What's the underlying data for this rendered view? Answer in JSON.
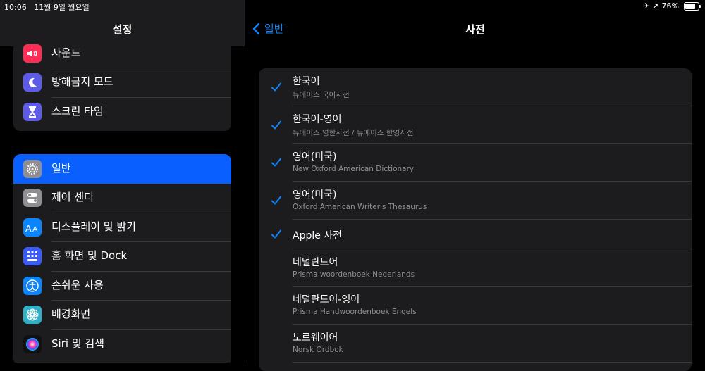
{
  "status": {
    "time": "10:06",
    "date": "11월 9일 월요일",
    "battery": "76%",
    "battery_level": 0.76
  },
  "sidebar": {
    "title": "설정",
    "group1": [
      {
        "label": "사운드",
        "icon": "speaker-icon",
        "color": "#ff2d55"
      },
      {
        "label": "방해금지 모드",
        "icon": "moon-icon",
        "color": "#5e5ce6"
      },
      {
        "label": "스크린 타임",
        "icon": "hourglass-icon",
        "color": "#5e5ce6"
      }
    ],
    "group2": [
      {
        "label": "일반",
        "icon": "gear-icon",
        "color": "#8e8e93",
        "selected": true
      },
      {
        "label": "제어 센터",
        "icon": "toggles-icon",
        "color": "#8e8e93"
      },
      {
        "label": "디스플레이 및 밝기",
        "icon": "text-size-icon",
        "color": "#0a84ff"
      },
      {
        "label": "홈 화면 및 Dock",
        "icon": "home-grid-icon",
        "color": "#3a5bff"
      },
      {
        "label": "손쉬운 사용",
        "icon": "accessibility-icon",
        "color": "#0a84ff"
      },
      {
        "label": "배경화면",
        "icon": "flower-icon",
        "color": "#30b0c7"
      },
      {
        "label": "Siri 및 검색",
        "icon": "siri-icon",
        "color": "#222"
      }
    ]
  },
  "detail": {
    "back_label": "일반",
    "title": "사전",
    "dictionaries": [
      {
        "name": "한국어",
        "sub": "뉴에이스 국어사전",
        "checked": true
      },
      {
        "name": "한국어-영어",
        "sub": "뉴에이스 영한사전 / 뉴에이스 한영사전",
        "checked": true
      },
      {
        "name": "영어(미국)",
        "sub": "New Oxford American Dictionary",
        "checked": true
      },
      {
        "name": "영어(미국)",
        "sub": "Oxford American Writer's Thesaurus",
        "checked": true
      },
      {
        "name": "Apple 사전",
        "sub": "",
        "checked": true
      },
      {
        "name": "네덜란드어",
        "sub": "Prisma woordenboek Nederlands",
        "checked": false
      },
      {
        "name": "네덜란드어-영어",
        "sub": "Prisma Handwoordenboek Engels",
        "checked": false
      },
      {
        "name": "노르웨이어",
        "sub": "Norsk Ordbok",
        "checked": false
      }
    ]
  },
  "colors": {
    "accent": "#0a84ff",
    "selected_row": "#0a60ff",
    "cell_bg": "#1c1c1e"
  }
}
